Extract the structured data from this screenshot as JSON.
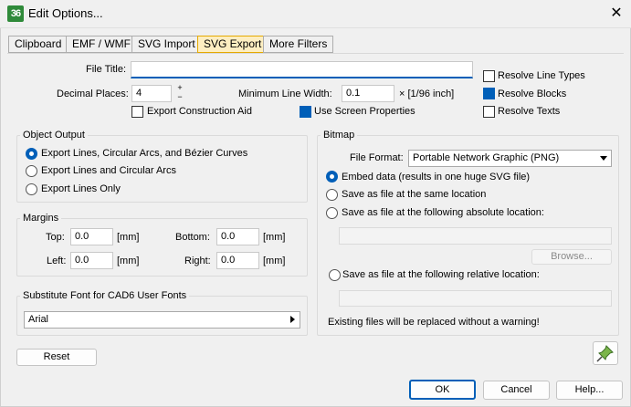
{
  "window": {
    "app_icon": "36",
    "title": "Edit Options...",
    "close_glyph": "✕"
  },
  "tabs": [
    {
      "label": "Clipboard",
      "active": false
    },
    {
      "label": "EMF / WMF",
      "active": false
    },
    {
      "label": "SVG Import",
      "active": false
    },
    {
      "label": "SVG Export",
      "active": true
    },
    {
      "label": "More Filters",
      "active": false
    }
  ],
  "form": {
    "file_title_label": "File Title:",
    "file_title_value": "",
    "decimal_places_label": "Decimal Places:",
    "decimal_places_value": "4",
    "spin_up": "+",
    "spin_down": "−",
    "min_line_width_label": "Minimum Line Width:",
    "min_line_width_value": "0.1",
    "min_line_width_unit": "× [1/96 inch]",
    "export_construction_aid": {
      "label": "Export Construction Aid",
      "checked": false
    },
    "use_screen_properties": {
      "label": "Use Screen Properties",
      "checked": true
    },
    "resolve_line_types": {
      "label": "Resolve Line Types",
      "checked": false
    },
    "resolve_blocks": {
      "label": "Resolve Blocks",
      "checked": true
    },
    "resolve_texts": {
      "label": "Resolve Texts",
      "checked": false
    }
  },
  "object_output": {
    "title": "Object Output",
    "options": [
      {
        "label": "Export Lines, Circular Arcs, and Bézier Curves",
        "selected": true
      },
      {
        "label": "Export Lines and Circular Arcs",
        "selected": false
      },
      {
        "label": "Export Lines Only",
        "selected": false
      }
    ]
  },
  "margins": {
    "title": "Margins",
    "top_label": "Top:",
    "top_value": "0.0",
    "bottom_label": "Bottom:",
    "bottom_value": "0.0",
    "left_label": "Left:",
    "left_value": "0.0",
    "right_label": "Right:",
    "right_value": "0.0",
    "unit": "[mm]"
  },
  "substitute_font": {
    "title": "Substitute Font for CAD6 User Fonts",
    "value": "Arial"
  },
  "bitmap": {
    "title": "Bitmap",
    "file_format_label": "File Format:",
    "file_format_value": "Portable Network Graphic (PNG)",
    "options": [
      {
        "label": "Embed data (results in one huge SVG file)",
        "selected": true
      },
      {
        "label": "Save as file at the same location",
        "selected": false
      },
      {
        "label": "Save as file at the following absolute location:",
        "selected": false
      },
      {
        "label": "Save as file at the following relative location:",
        "selected": false
      }
    ],
    "absolute_path": "",
    "relative_path": "",
    "browse_label": "Browse...",
    "warning": "Existing files will be replaced without a warning!"
  },
  "buttons": {
    "reset": "Reset",
    "ok": "OK",
    "cancel": "Cancel",
    "help": "Help..."
  },
  "icons": {
    "pin": "pushpin-icon",
    "close": "close-icon",
    "dropdown": "chevron-down-icon",
    "submenu": "chevron-right-icon"
  }
}
